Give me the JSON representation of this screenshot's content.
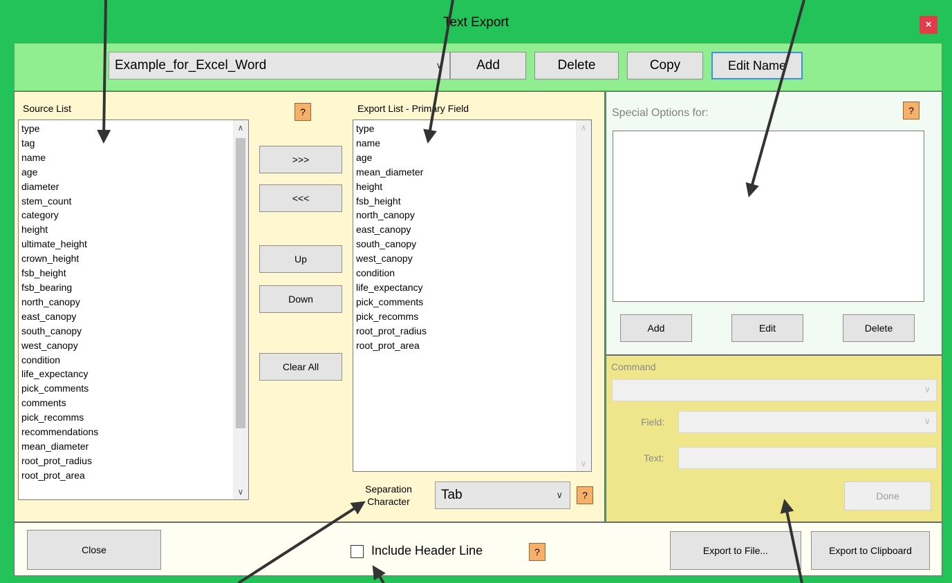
{
  "window": {
    "title": "Text Export",
    "close_label": "×"
  },
  "toolbar": {
    "preset_value": "Example_for_Excel_Word",
    "add_label": "Add",
    "delete_label": "Delete",
    "copy_label": "Copy",
    "edit_name_label": "Edit Name"
  },
  "source": {
    "title": "Source List",
    "items": [
      "type",
      "tag",
      "name",
      "age",
      "diameter",
      "stem_count",
      "category",
      "height",
      "ultimate_height",
      "crown_height",
      "fsb_height",
      "fsb_bearing",
      "north_canopy",
      "east_canopy",
      "south_canopy",
      "west_canopy",
      "condition",
      "life_expectancy",
      "pick_comments",
      "comments",
      "pick_recomms",
      "recommendations",
      "mean_diameter",
      "root_prot_radius",
      "root_prot_area"
    ]
  },
  "middle": {
    "help_label": "?",
    "add_to_export_label": ">>>",
    "remove_from_export_label": "<<<",
    "up_label": "Up",
    "down_label": "Down",
    "clear_all_label": "Clear All"
  },
  "export": {
    "title": "Export List - Primary Field",
    "items": [
      "type",
      "name",
      "age",
      "mean_diameter",
      "height",
      "fsb_height",
      "north_canopy",
      "east_canopy",
      "south_canopy",
      "west_canopy",
      "condition",
      "life_expectancy",
      "pick_comments",
      "pick_recomms",
      "root_prot_radius",
      "root_prot_area"
    ]
  },
  "separation": {
    "label_line1": "Separation",
    "label_line2": "Character",
    "value": "Tab",
    "help_label": "?"
  },
  "special": {
    "title": "Special Options for:",
    "help_label": "?",
    "add_label": "Add",
    "edit_label": "Edit",
    "delete_label": "Delete"
  },
  "command": {
    "title": "Command",
    "field_label": "Field:",
    "text_label": "Text:",
    "done_label": "Done"
  },
  "footer": {
    "close_label": "Close",
    "include_header_label": "Include Header Line",
    "include_header_checked": false,
    "help_label": "?",
    "export_file_label": "Export to File...",
    "export_clipboard_label": "Export to Clipboard"
  },
  "colors": {
    "window": "#24c35a",
    "toolbar_bg": "#90ee90",
    "list_panel_bg": "#fef7d0",
    "special_bg": "#f1fbf3",
    "command_bg": "#efe58a",
    "help_bg": "#f7b06a",
    "close_bg": "#e03b48"
  },
  "icons": [
    "chevron-down-icon",
    "scroll-up-icon",
    "scroll-down-icon",
    "close-icon",
    "annotation-arrow"
  ]
}
